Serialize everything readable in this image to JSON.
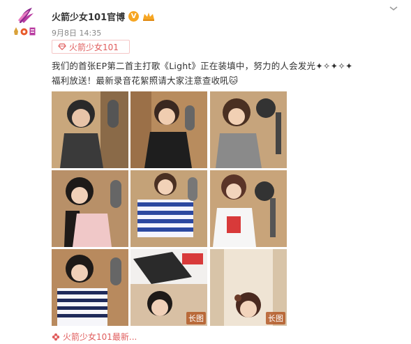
{
  "post": {
    "author": "火箭少女101官博",
    "vip_badge": "V",
    "date": "9月8日 14:35",
    "topic": "火箭少女101",
    "text_line1": "我们的首张EP第二首主打歌《Light》正在装填中，努力的人会发光✦✧✦✧✦",
    "text_line2": "福利放送！最新录音花絮照请大家注意查收吼🐱",
    "images": [
      {
        "tag": ""
      },
      {
        "tag": ""
      },
      {
        "tag": ""
      },
      {
        "tag": ""
      },
      {
        "tag": ""
      },
      {
        "tag": ""
      },
      {
        "tag": ""
      },
      {
        "tag": "长图"
      },
      {
        "tag": "长图"
      }
    ],
    "footer_source": "火箭少女101最新..."
  },
  "icons": {
    "avatar": "rocket-girls-logo-icon",
    "menu": "chevron-down-icon",
    "topic": "diamond-icon",
    "footer": "flower-icon"
  },
  "colors": {
    "accent_red": "#e05d5d",
    "vip_orange": "#f6a623",
    "logo_purple": "#8e2b8e"
  }
}
